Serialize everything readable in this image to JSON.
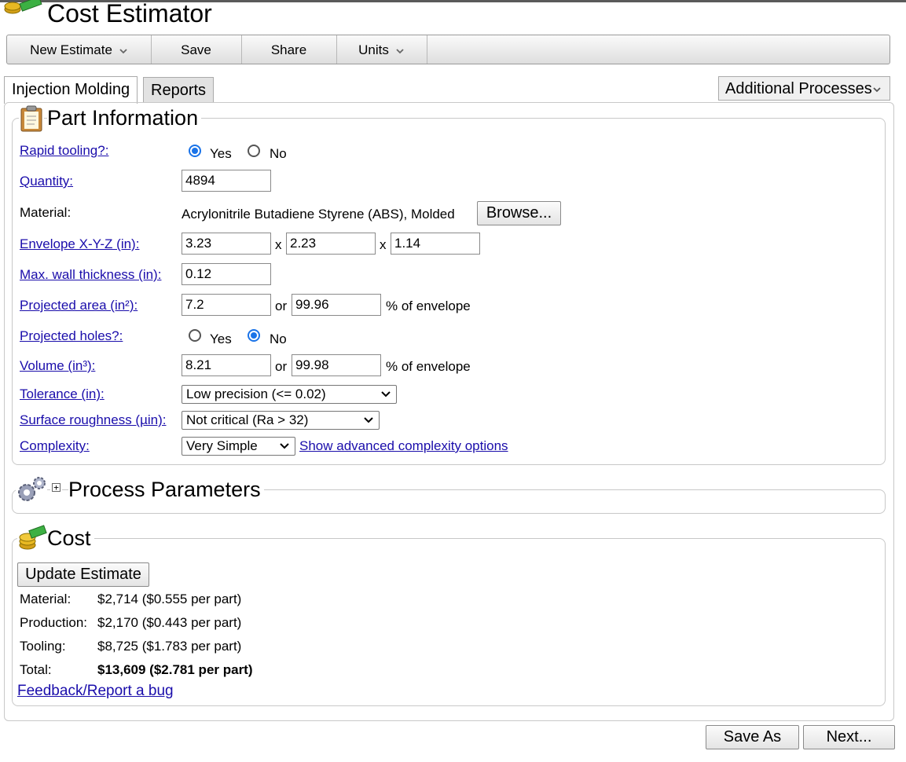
{
  "app": {
    "title": "Cost Estimator"
  },
  "menubar": {
    "items": [
      {
        "label": "New Estimate",
        "dropdown": true
      },
      {
        "label": "Save",
        "dropdown": false
      },
      {
        "label": "Share",
        "dropdown": false
      },
      {
        "label": "Units",
        "dropdown": true
      }
    ]
  },
  "tabs": [
    {
      "label": "Injection Molding",
      "active": true
    },
    {
      "label": "Reports",
      "active": false
    }
  ],
  "additional_processes": {
    "label": "Additional Processes"
  },
  "part_info": {
    "title": "Part Information",
    "rapid_tooling": {
      "label": "Rapid tooling?:",
      "yes": "Yes",
      "no": "No",
      "selected": "Yes"
    },
    "quantity": {
      "label": "Quantity:",
      "value": "4894"
    },
    "material": {
      "label": "Material:",
      "value": "Acrylonitrile Butadiene Styrene (ABS), Molded",
      "browse": "Browse..."
    },
    "envelope": {
      "label": "Envelope X-Y-Z (in):",
      "x": "3.23",
      "y": "2.23",
      "z": "1.14",
      "sep": "x"
    },
    "wall": {
      "label": "Max. wall thickness (in):",
      "value": "0.12"
    },
    "projected_area": {
      "label": "Projected area (in²):",
      "value": "7.2",
      "or": "or",
      "percent": "99.96",
      "suffix": "% of envelope"
    },
    "projected_holes": {
      "label": "Projected holes?:",
      "yes": "Yes",
      "no": "No",
      "selected": "No"
    },
    "volume": {
      "label": "Volume (in³):",
      "value": "8.21",
      "or": "or",
      "percent": "99.98",
      "suffix": "% of envelope"
    },
    "tolerance": {
      "label": "Tolerance (in):",
      "value": "Low precision (<= 0.02)"
    },
    "roughness": {
      "label": "Surface roughness (µin):",
      "value": "Not critical (Ra > 32)"
    },
    "complexity": {
      "label": "Complexity:",
      "value": "Very Simple",
      "advanced_link": "Show advanced complexity options"
    }
  },
  "process_params": {
    "title": "Process Parameters",
    "expand": "+"
  },
  "cost": {
    "title": "Cost",
    "update_button": "Update Estimate",
    "rows": [
      {
        "label": "Material:",
        "value": "$2,714 ($0.555 per part)"
      },
      {
        "label": "Production:",
        "value": "$2,170 ($0.443 per part)"
      },
      {
        "label": "Tooling:",
        "value": "$8,725 ($1.783 per part)"
      },
      {
        "label": "Total:",
        "value": "$13,609 ($2.781 per part)"
      }
    ],
    "feedback": "Feedback/Report a bug"
  },
  "footer": {
    "save_as": "Save As",
    "next": "Next..."
  },
  "colors": {
    "link": "#1a0dab",
    "radio_selected": "#1a73e8",
    "coin_gold": "#d4a017",
    "money_green": "#3cb043"
  }
}
